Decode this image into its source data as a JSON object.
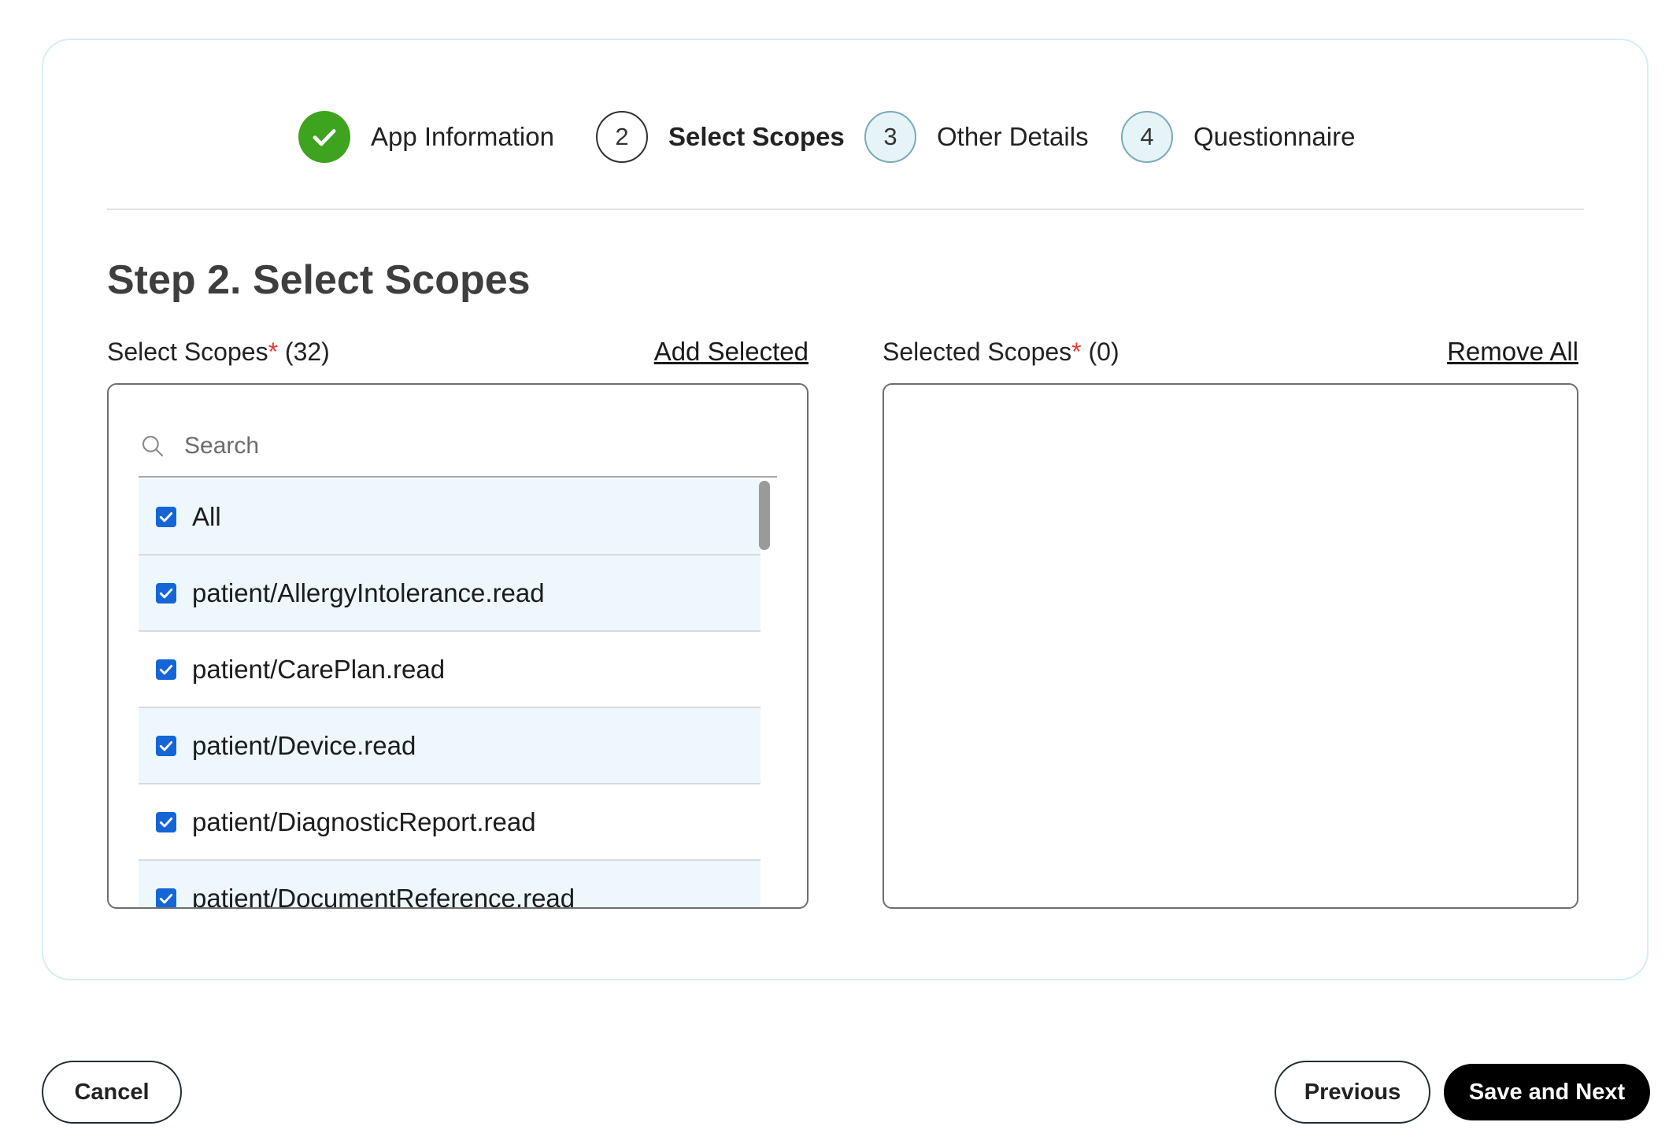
{
  "stepper": {
    "steps": [
      {
        "number": "",
        "label": "App Information",
        "state": "done",
        "icon": "check-icon"
      },
      {
        "number": "2",
        "label": "Select Scopes",
        "state": "active"
      },
      {
        "number": "3",
        "label": "Other Details",
        "state": "pending"
      },
      {
        "number": "4",
        "label": "Questionnaire",
        "state": "pending"
      }
    ]
  },
  "page_title": "Step 2. Select Scopes",
  "available": {
    "label": "Select Scopes",
    "required_mark": "*",
    "count": "(32)",
    "action": "Add Selected",
    "search_placeholder": "Search",
    "items": [
      {
        "label": "All",
        "checked": true
      },
      {
        "label": "patient/AllergyIntolerance.read",
        "checked": true
      },
      {
        "label": "patient/CarePlan.read",
        "checked": true
      },
      {
        "label": "patient/Device.read",
        "checked": true
      },
      {
        "label": "patient/DiagnosticReport.read",
        "checked": true
      },
      {
        "label": "patient/DocumentReference.read",
        "checked": true
      }
    ]
  },
  "selected": {
    "label": "Selected Scopes",
    "required_mark": "*",
    "count": "(0)",
    "action": "Remove All"
  },
  "footer": {
    "cancel_label": "Cancel",
    "previous_label": "Previous",
    "next_label": "Save and Next"
  },
  "colors": {
    "done_green": "#3ea31f",
    "checkbox_blue": "#1565d8",
    "required_red": "#e53935",
    "row_highlight": "#edf7fc",
    "card_border": "#d6eef4"
  }
}
